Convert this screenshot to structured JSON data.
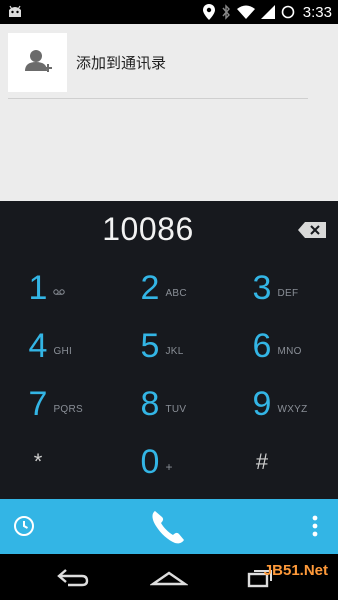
{
  "status_bar": {
    "time": "3:33",
    "icons": [
      "android-icon",
      "location-icon",
      "bluetooth-icon",
      "wifi-icon",
      "signal-icon",
      "sync-icon"
    ]
  },
  "suggestion": {
    "label": "添加到通讯录",
    "icon": "add-contact-icon"
  },
  "dialer": {
    "number": "10086",
    "keys": [
      {
        "digit": "1",
        "letters": ""
      },
      {
        "digit": "2",
        "letters": "ABC"
      },
      {
        "digit": "3",
        "letters": "DEF"
      },
      {
        "digit": "4",
        "letters": "GHI"
      },
      {
        "digit": "5",
        "letters": "JKL"
      },
      {
        "digit": "6",
        "letters": "MNO"
      },
      {
        "digit": "7",
        "letters": "PQRS"
      },
      {
        "digit": "8",
        "letters": "TUV"
      },
      {
        "digit": "9",
        "letters": "WXYZ"
      },
      {
        "digit": "*",
        "letters": ""
      },
      {
        "digit": "0",
        "letters": "+"
      },
      {
        "digit": "#",
        "letters": ""
      }
    ]
  },
  "action_bar": {
    "color": "#33b5e5",
    "icons": [
      "history-icon",
      "phone-icon",
      "overflow-icon"
    ]
  },
  "watermark": "JB51.Net",
  "colors": {
    "accent": "#33b5e5",
    "dialer_bg": "#17191e",
    "top_bg": "#ececec"
  }
}
